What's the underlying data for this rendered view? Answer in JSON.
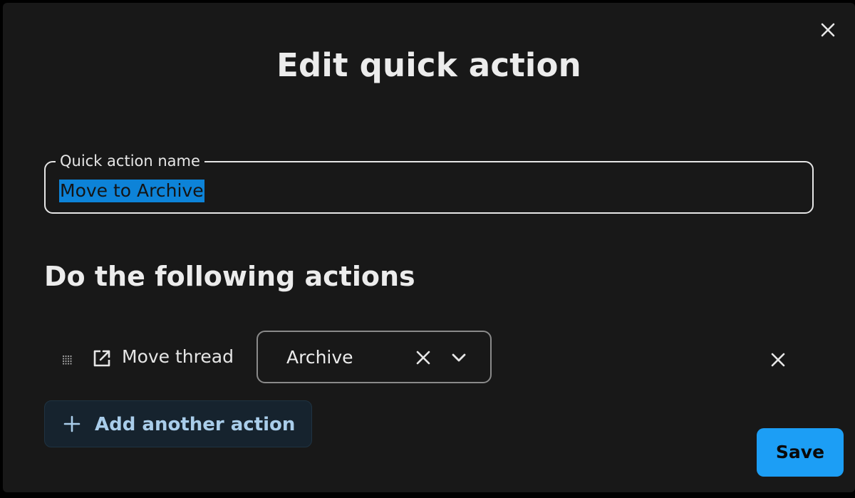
{
  "dialog": {
    "title": "Edit quick action",
    "close_icon": "close-icon"
  },
  "name_field": {
    "label": "Quick action name",
    "value": "Move to Archive",
    "text_selected": true
  },
  "actions_section": {
    "heading": "Do the following actions",
    "actions": [
      {
        "drag_icon": "drag-handle-icon",
        "type_icon": "external-link-icon",
        "label": "Move thread",
        "selected_value": "Archive",
        "clear_icon": "close-icon",
        "dropdown_icon": "chevron-down-icon",
        "remove_icon": "close-icon"
      }
    ],
    "add_button": {
      "icon": "plus-icon",
      "label": "Add another action"
    }
  },
  "footer": {
    "save_label": "Save"
  },
  "colors": {
    "background": "#181818",
    "text": "#ececec",
    "selection": "#0d83d8",
    "accent": "#1c9ef5",
    "secondary_button_bg": "#16232e",
    "secondary_button_text": "#a9cdea"
  }
}
